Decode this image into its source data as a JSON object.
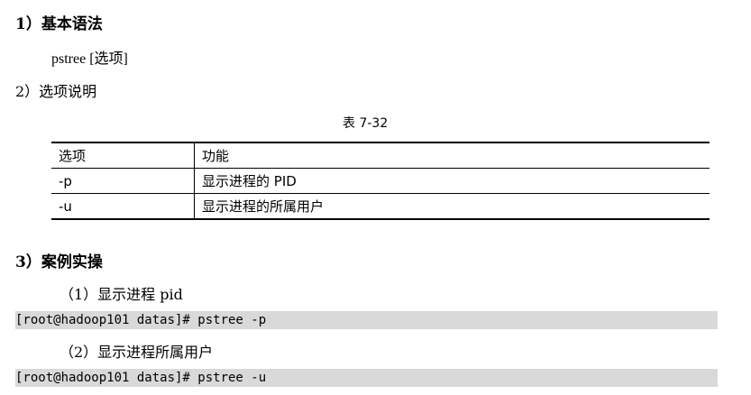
{
  "sections": {
    "syntax_heading": "1）基本语法",
    "syntax_line": "pstree [选项]",
    "options_heading": "2）选项说明",
    "table_caption": "表 7-32",
    "example_heading": "3）案例实操"
  },
  "options_table": {
    "headers": [
      "选项",
      "功能"
    ],
    "rows": [
      [
        "-p",
        "显示进程的 PID"
      ],
      [
        "-u",
        "显示进程的所属用户"
      ]
    ]
  },
  "examples": [
    {
      "label": "（1）显示进程 pid",
      "command": "[root@hadoop101 datas]# pstree -p"
    },
    {
      "label": "（2）显示进程所属用户",
      "command": "[root@hadoop101 datas]# pstree -u"
    }
  ],
  "colors": {
    "code_background": "#d9d9d9",
    "text": "#000000"
  }
}
